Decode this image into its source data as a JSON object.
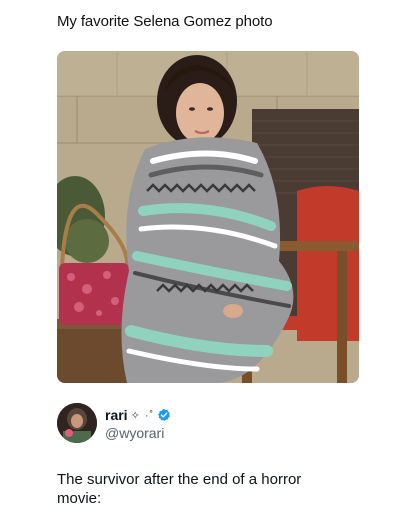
{
  "caption": "My favorite Selena Gomez photo",
  "photo": {
    "icon": "portrait-photo",
    "colors": {
      "wall": "#b9aa8d",
      "blanket_gray": "#9a9a9c",
      "blanket_mint": "#8fd3bf",
      "chair_red": "#c23a2a",
      "wood": "#8a5a30"
    }
  },
  "tweet": {
    "display_name": "rari",
    "name_decoration": "✧ ·˚",
    "handle": "@wyorari",
    "text": "The survivor after the end of a horror movie:",
    "verified_color": "#1d9bf0"
  }
}
